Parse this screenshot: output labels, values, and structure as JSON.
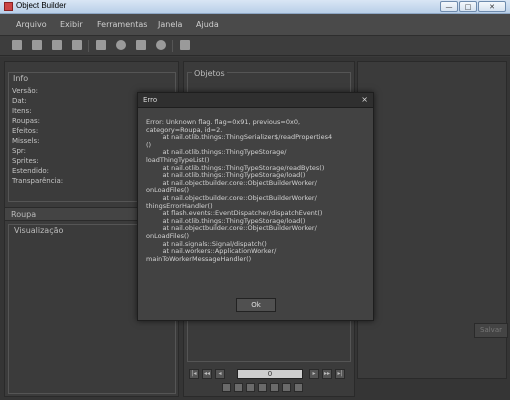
{
  "window": {
    "title": "Object Builder",
    "minimize_label": "—",
    "maximize_label": "□",
    "close_label": "✕"
  },
  "menu": {
    "items": [
      "Arquivo",
      "Exibir",
      "Ferramentas",
      "Janela",
      "Ajuda"
    ]
  },
  "toolbar": {
    "icons": [
      "new-icon",
      "open-icon",
      "save-icon",
      "save-as-icon",
      "compile-icon",
      "search-icon",
      "grid-icon",
      "animation-icon",
      "settings-icon"
    ]
  },
  "info_panel": {
    "title": "Info",
    "rows": [
      "Versão:",
      "Dat:",
      "Itens:",
      "Roupas:",
      "Efeitos:",
      "Missels:",
      "Spr:",
      "Sprites:",
      "Estendido:",
      "Transparência:"
    ]
  },
  "roupa_panel": {
    "title": "Roupa",
    "visualization_label": "Visualização"
  },
  "objects_panel": {
    "title": "Objetos",
    "page_value": "0",
    "pager_icons": [
      "first-page-icon",
      "previous-page-icon",
      "next-page-icon",
      "last-page-icon"
    ],
    "action_icons": [
      "replace-icon",
      "export-icon",
      "edit-icon",
      "duplicate-icon",
      "add-icon",
      "delete-icon",
      "trash-icon"
    ]
  },
  "save_button": "Salvar",
  "dialog": {
    "title": "Erro",
    "close": "×",
    "message": "Error: Unknown flag. flag=0x91, previous=0x0,\ncategory=Roupa, id=2.\n        at nail.otlib.things::ThingSerializer$/readProperties4\n()\n        at nail.otlib.things::ThingTypeStorage/\nloadThingTypeList()\n        at nail.otlib.things::ThingTypeStorage/readBytes()\n        at nail.otlib.things::ThingTypeStorage/load()\n        at nail.objectbuilder.core::ObjectBuilderWorker/\nonLoadFiles()\n        at nail.objectbuilder.core::ObjectBuilderWorker/\nthingsErrorHandler()\n        at flash.events::EventDispatcher/dispatchEvent()\n        at nail.otlib.things::ThingTypeStorage/load()\n        at nail.objectbuilder.core::ObjectBuilderWorker/\nonLoadFiles()\n        at nail.signals::Signal/dispatch()\n        at nail.workers::ApplicationWorker/\nmainToWorkerMessageHandler()",
    "ok_label": "Ok"
  }
}
